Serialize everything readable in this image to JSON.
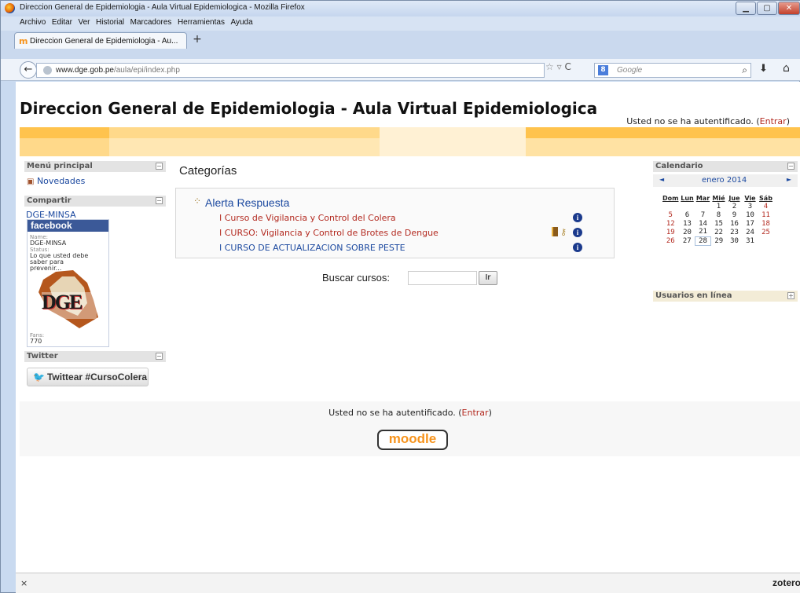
{
  "browser": {
    "window_title": "Direccion General de Epidemiologia - Aula Virtual Epidemiologica - Mozilla Firefox",
    "menu": [
      "Archivo",
      "Editar",
      "Ver",
      "Historial",
      "Marcadores",
      "Herramientas",
      "Ayuda"
    ],
    "tab_title": "Direccion General de Epidemiologia - Au...",
    "new_tab": "+",
    "url_host": "www.dge.gob.pe",
    "url_path": "/aula/epi/index.php",
    "search_placeholder": "Google",
    "status_close": "×",
    "status_zotero": "zotero"
  },
  "page": {
    "site_title": "Direccion General de Epidemiologia - Aula Virtual Epidemiologica",
    "login_text": "Usted no se ha autentificado. (",
    "login_link": "Entrar",
    "login_close": ")"
  },
  "left": {
    "main_menu": {
      "title": "Menú principal",
      "item": "Novedades"
    },
    "share": {
      "title": "Compartir",
      "link": "DGE-MINSA",
      "fb_brand": "facebook",
      "name_label": "Name:",
      "name_value": "DGE-MINSA",
      "status_label": "Status:",
      "status_value": "Lo que usted debe saber para prevenir...",
      "logo_text": "DGE",
      "fans_label": "Fans:",
      "fans_value": "770"
    },
    "twitter": {
      "title": "Twitter",
      "button": "Twittear #CursoColera"
    }
  },
  "main": {
    "heading": "Categorías",
    "category": "Alerta Respuesta",
    "courses": [
      {
        "name": "I Curso de Vigilancia y Control del Colera",
        "color": "#b32a20"
      },
      {
        "name": "I CURSO: Vigilancia y Control de Brotes de Dengue",
        "color": "#b32a20"
      },
      {
        "name": "I CURSO DE ACTUALIZACION SOBRE PESTE",
        "color": "#1d4aa0"
      }
    ],
    "search_label": "Buscar cursos:",
    "search_button": "Ir"
  },
  "calendar": {
    "title": "Calendario",
    "month": "enero 2014",
    "prev": "◄",
    "next": "►",
    "weekdays": [
      "Dom",
      "Lun",
      "Mar",
      "Mié",
      "Jue",
      "Vie",
      "Sáb"
    ],
    "weeks": [
      [
        "",
        "",
        "",
        "1",
        "2",
        "3",
        "4"
      ],
      [
        "5",
        "6",
        "7",
        "8",
        "9",
        "10",
        "11"
      ],
      [
        "12",
        "13",
        "14",
        "15",
        "16",
        "17",
        "18"
      ],
      [
        "19",
        "20",
        "21",
        "22",
        "23",
        "24",
        "25"
      ],
      [
        "26",
        "27",
        "28",
        "29",
        "30",
        "31",
        ""
      ]
    ],
    "today": "28"
  },
  "online_users": {
    "title": "Usuarios en línea"
  },
  "footer": {
    "login_text": "Usted no se ha autentificado. (",
    "login_link": "Entrar",
    "login_close": ")",
    "logo": "moodle"
  },
  "colors": {
    "band_orange": "#ffc34d",
    "band_light": "#ffe7b3",
    "link_blue": "#1d4aa0",
    "link_red": "#b32a20",
    "fb_blue": "#3b5998"
  }
}
